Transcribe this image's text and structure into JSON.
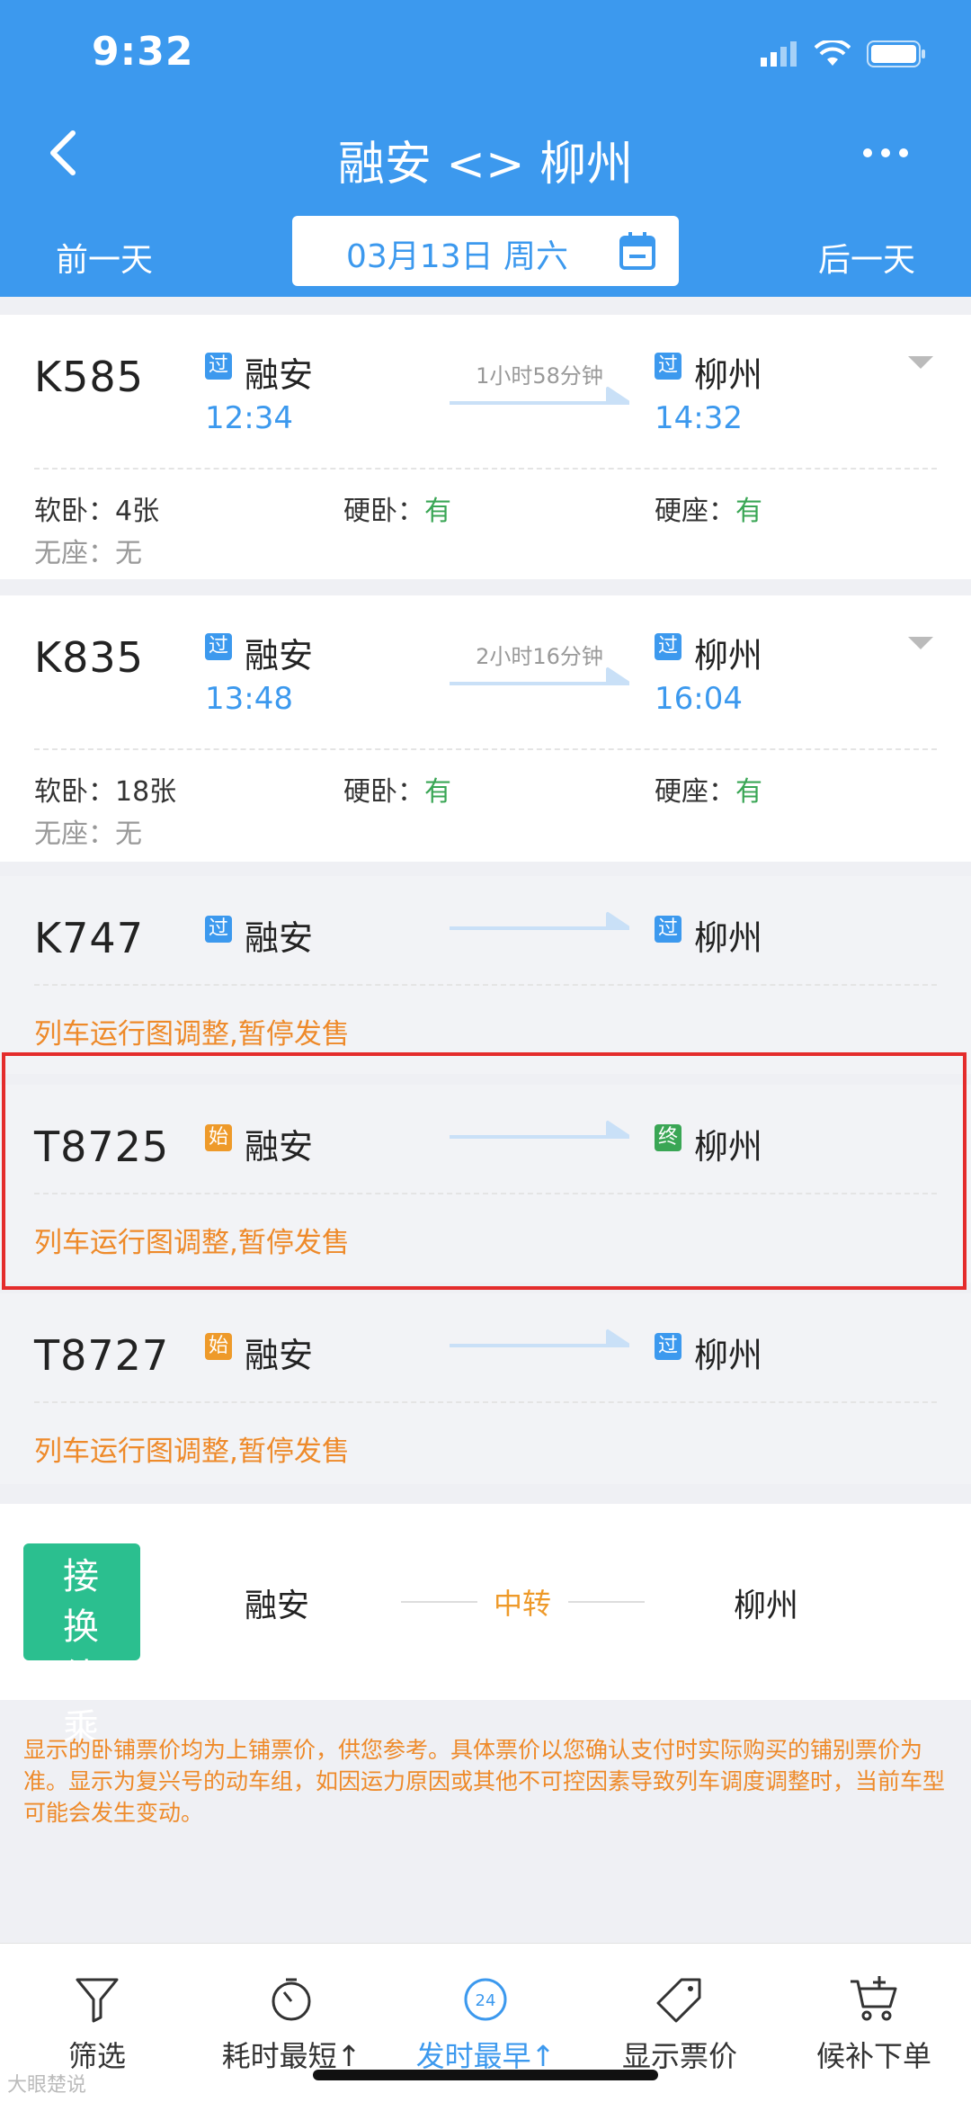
{
  "status_bar": {
    "time": "9:32"
  },
  "header": {
    "title": "融安 <> 柳州",
    "prev_day": "前一天",
    "next_day": "后一天",
    "date": "03月13日 周六"
  },
  "trains": [
    {
      "number": "K585",
      "from_badge": "过",
      "from": "融安",
      "depart": "12:34",
      "duration": "1小时58分钟",
      "to_badge": "过",
      "to": "柳州",
      "arrive": "14:32",
      "seats": [
        {
          "label": "软卧：",
          "value": "4张"
        },
        {
          "label": "硬卧：",
          "value": "有"
        },
        {
          "label": "硬座：",
          "value": "有"
        },
        {
          "label": "无座：",
          "value": "无"
        }
      ]
    },
    {
      "number": "K835",
      "from_badge": "过",
      "from": "融安",
      "depart": "13:48",
      "duration": "2小时16分钟",
      "to_badge": "过",
      "to": "柳州",
      "arrive": "16:04",
      "seats": [
        {
          "label": "软卧：",
          "value": "18张"
        },
        {
          "label": "硬卧：",
          "value": "有"
        },
        {
          "label": "硬座：",
          "value": "有"
        },
        {
          "label": "无座：",
          "value": "无"
        }
      ]
    },
    {
      "number": "K747",
      "from_badge": "过",
      "from": "融安",
      "to_badge": "过",
      "to": "柳州",
      "notice": "列车运行图调整,暂停发售"
    },
    {
      "number": "T8725",
      "from_badge": "始",
      "from": "融安",
      "to_badge": "终",
      "to": "柳州",
      "notice": "列车运行图调整,暂停发售"
    },
    {
      "number": "T8727",
      "from_badge": "始",
      "from": "融安",
      "to_badge": "过",
      "to": "柳州",
      "notice": "列车运行图调整,暂停发售"
    }
  ],
  "transfer": {
    "tag_line1": "接换",
    "tag_line2": "续乘",
    "from": "融安",
    "middle": "中转",
    "to": "柳州"
  },
  "disclaimer": "显示的卧铺票价均为上铺票价，供您参考。具体票价以您确认支付时实际购买的铺别票价为准。显示为复兴号的动车组，如因运力原因或其他不可控因素导致列车调度调整时，当前车型可能会发生变动。",
  "bottom_nav": [
    {
      "label": "筛选",
      "icon": "filter-icon"
    },
    {
      "label": "耗时最短↑",
      "icon": "timer-icon"
    },
    {
      "label": "发时最早↑",
      "icon": "clock-24-icon",
      "icon_text": "24",
      "active": true
    },
    {
      "label": "显示票价",
      "icon": "price-tag-icon"
    },
    {
      "label": "候补下单",
      "icon": "cart-add-icon"
    }
  ],
  "watermark": "大眼楚说",
  "colors": {
    "primary": "#3c99ee",
    "orange": "#ee8a2a",
    "green": "#3aa655",
    "highlight": "#e42c2c",
    "transfer": "#2bbf8f"
  }
}
